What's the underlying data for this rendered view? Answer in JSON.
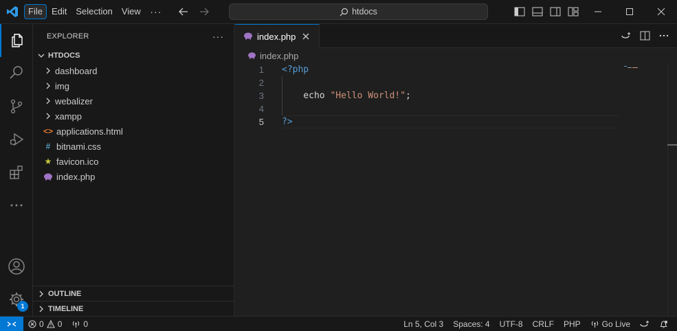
{
  "titlebar": {
    "menu": [
      "File",
      "Edit",
      "Selection",
      "View"
    ],
    "menu_more": "···",
    "search": "htdocs"
  },
  "sidebar": {
    "title": "EXPLORER",
    "more": "···",
    "root": "HTDOCS",
    "folders": [
      "dashboard",
      "img",
      "webalizer",
      "xampp"
    ],
    "files": [
      {
        "name": "applications.html",
        "icon": "html-icon",
        "glyph": "<>",
        "color": "#e37933"
      },
      {
        "name": "bitnami.css",
        "icon": "css-icon",
        "glyph": "#",
        "color": "#519aba"
      },
      {
        "name": "favicon.ico",
        "icon": "star-icon",
        "glyph": "★",
        "color": "#cbcb41"
      },
      {
        "name": "index.php",
        "icon": "php-elephant-icon",
        "glyph": "",
        "color": "#a074c4"
      }
    ],
    "outline": "OUTLINE",
    "timeline": "TIMELINE"
  },
  "activity": {
    "badge": "1"
  },
  "editor": {
    "tab": "index.php",
    "breadcrumb": "index.php",
    "lines": [
      {
        "n": "1",
        "segs": [
          {
            "t": "<?php",
            "c": "kw"
          }
        ]
      },
      {
        "n": "2",
        "segs": []
      },
      {
        "n": "3",
        "segs": [
          {
            "t": "    echo ",
            "c": "plain"
          },
          {
            "t": "\"Hello World!\"",
            "c": "str"
          },
          {
            "t": ";",
            "c": "plain"
          }
        ]
      },
      {
        "n": "4",
        "segs": []
      },
      {
        "n": "5",
        "segs": [
          {
            "t": "?>",
            "c": "kw"
          }
        ]
      }
    ]
  },
  "status": {
    "errors": "0",
    "warnings": "0",
    "ports": "0",
    "position": "Ln 5, Col 3",
    "spaces": "Spaces: 4",
    "encoding": "UTF-8",
    "eol": "CRLF",
    "language": "PHP",
    "golive": "Go Live"
  },
  "colors": {
    "accent": "#0078d4",
    "php_purple": "#a074c4",
    "keyword": "#569cd6",
    "string": "#ce9178"
  }
}
